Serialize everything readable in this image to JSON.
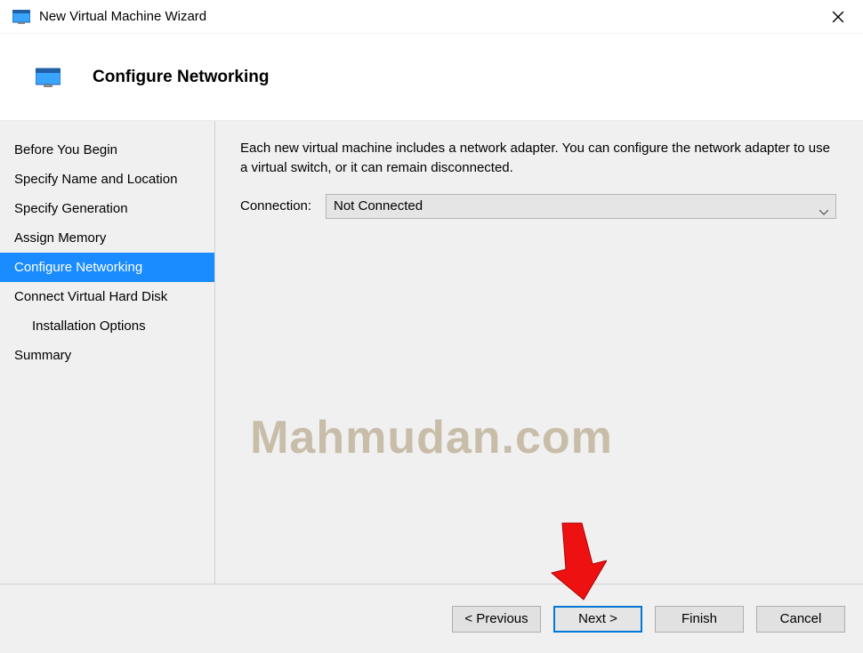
{
  "window": {
    "title": "New Virtual Machine Wizard"
  },
  "page": {
    "heading": "Configure Networking",
    "description": "Each new virtual machine includes a network adapter. You can configure the network adapter to use a virtual switch, or it can remain disconnected.",
    "connection_label": "Connection:",
    "connection_value": "Not Connected"
  },
  "sidebar": {
    "items": [
      {
        "label": "Before You Begin",
        "active": false,
        "indent": false
      },
      {
        "label": "Specify Name and Location",
        "active": false,
        "indent": false
      },
      {
        "label": "Specify Generation",
        "active": false,
        "indent": false
      },
      {
        "label": "Assign Memory",
        "active": false,
        "indent": false
      },
      {
        "label": "Configure Networking",
        "active": true,
        "indent": false
      },
      {
        "label": "Connect Virtual Hard Disk",
        "active": false,
        "indent": false
      },
      {
        "label": "Installation Options",
        "active": false,
        "indent": true
      },
      {
        "label": "Summary",
        "active": false,
        "indent": false
      }
    ]
  },
  "footer": {
    "previous": "< Previous",
    "next": "Next >",
    "finish": "Finish",
    "cancel": "Cancel"
  },
  "watermark": "Mahmudan.com"
}
